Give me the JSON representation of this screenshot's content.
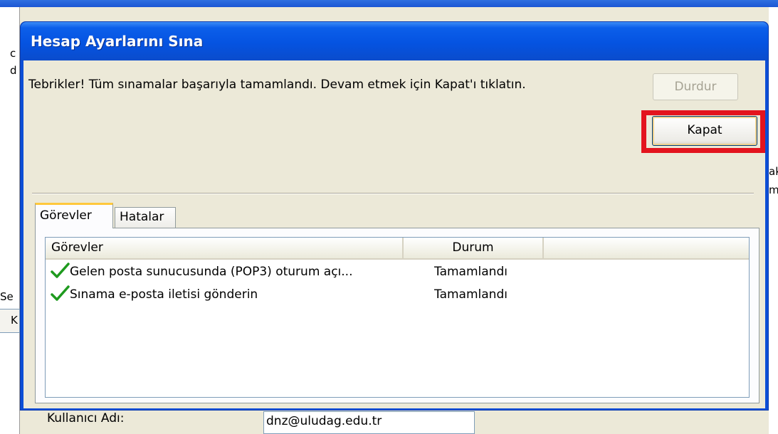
{
  "background": {
    "left_fragments": [
      "c",
      "d",
      "Se",
      "K"
    ],
    "right_fragments": [
      "ak",
      "m"
    ],
    "username_label": "Kullanıcı Adı:",
    "username_value": "dnz@uludag.edu.tr"
  },
  "dialog": {
    "title": "Hesap Ayarlarını Sına",
    "message": "Tebrikler! Tüm sınamalar başarıyla tamamlandı. Devam etmek için Kapat'ı tıklatın.",
    "stop_label": "Durdur",
    "close_label": "Kapat",
    "tabs": [
      {
        "label": "Görevler",
        "active": true
      },
      {
        "label": "Hatalar",
        "active": false
      }
    ],
    "columns": [
      "Görevler",
      "Durum"
    ],
    "rows": [
      {
        "icon": "checkmark-icon",
        "task": "Gelen posta sunucusunda (POP3) oturum açı...",
        "status": "Tamamlandı"
      },
      {
        "icon": "checkmark-icon",
        "task": "Sınama e-posta iletisi gönderin",
        "status": "Tamamlandı"
      }
    ]
  },
  "colors": {
    "titlebar": "#0553e1",
    "highlight": "#e3141e",
    "check": "#1e9a1e"
  }
}
